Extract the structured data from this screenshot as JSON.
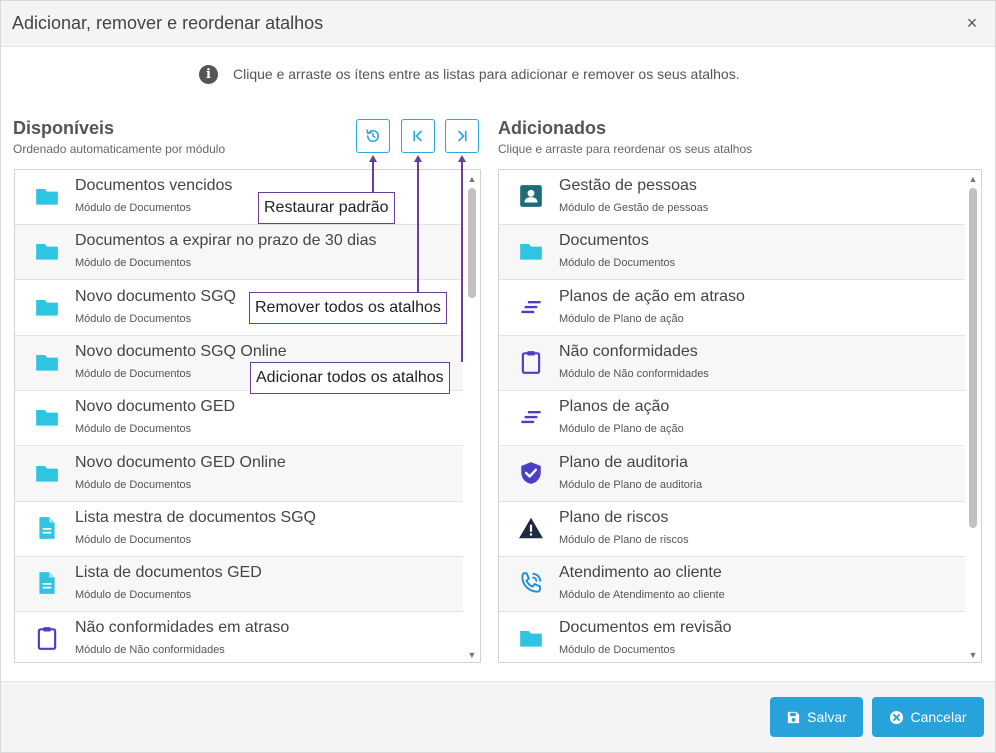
{
  "dialog": {
    "title": "Adicionar, remover e reordenar atalhos",
    "close_label": "×",
    "info_text": "Clique e arraste os ítens entre as listas para adicionar e remover os seus atalhos."
  },
  "available": {
    "title": "Disponíveis",
    "subtitle": "Ordenado automaticamente por módulo",
    "items": [
      {
        "title": "Documentos vencidos",
        "module": "Módulo de Documentos",
        "icon": "folder-icon"
      },
      {
        "title": "Documentos a expirar no prazo de 30 dias",
        "module": "Módulo de Documentos",
        "icon": "folder-icon"
      },
      {
        "title": "Novo documento SGQ",
        "module": "Módulo de Documentos",
        "icon": "folder-icon"
      },
      {
        "title": "Novo documento SGQ Online",
        "module": "Módulo de Documentos",
        "icon": "folder-icon"
      },
      {
        "title": "Novo documento GED",
        "module": "Módulo de Documentos",
        "icon": "folder-icon"
      },
      {
        "title": "Novo documento GED Online",
        "module": "Módulo de Documentos",
        "icon": "folder-icon"
      },
      {
        "title": "Lista mestra de documentos SGQ",
        "module": "Módulo de Documentos",
        "icon": "document-icon"
      },
      {
        "title": "Lista de documentos GED",
        "module": "Módulo de Documentos",
        "icon": "document-icon"
      },
      {
        "title": "Não conformidades em atraso",
        "module": "Módulo de Não conformidades",
        "icon": "clipboard-icon"
      }
    ]
  },
  "added": {
    "title": "Adicionados",
    "subtitle": "Clique e arraste para reordenar os seus atalhos",
    "items": [
      {
        "title": "Gestão de pessoas",
        "module": "Módulo de Gestão de pessoas",
        "icon": "contact-card-icon"
      },
      {
        "title": "Documentos",
        "module": "Módulo de Documentos",
        "icon": "folder-icon"
      },
      {
        "title": "Planos de ação em atraso",
        "module": "Módulo de Plano de ação",
        "icon": "lines-icon"
      },
      {
        "title": "Não conformidades",
        "module": "Módulo de Não conformidades",
        "icon": "clipboard-icon"
      },
      {
        "title": "Planos de ação",
        "module": "Módulo de Plano de ação",
        "icon": "lines-icon"
      },
      {
        "title": "Plano de auditoria",
        "module": "Módulo de Plano de auditoria",
        "icon": "shield-check-icon"
      },
      {
        "title": "Plano de riscos",
        "module": "Módulo de Plano de riscos",
        "icon": "warning-icon"
      },
      {
        "title": "Atendimento ao cliente",
        "module": "Módulo de Atendimento ao cliente",
        "icon": "phone-icon"
      },
      {
        "title": "Documentos em revisão",
        "module": "Módulo de Documentos",
        "icon": "folder-icon"
      }
    ]
  },
  "tools": {
    "restore_icon": "restore-icon",
    "remove_all_icon": "move-first-icon",
    "add_all_icon": "move-last-icon"
  },
  "callouts": {
    "restore": "Restaurar padrão",
    "remove_all": "Remover todos os atalhos",
    "add_all": "Adicionar todos os atalhos"
  },
  "footer": {
    "save_label": "Salvar",
    "cancel_label": "Cancelar"
  },
  "colors": {
    "accent": "#28a2db",
    "folder": "#2ec4e2",
    "purple": "#4b3fc8",
    "callout_border": "#6a3d9a"
  }
}
